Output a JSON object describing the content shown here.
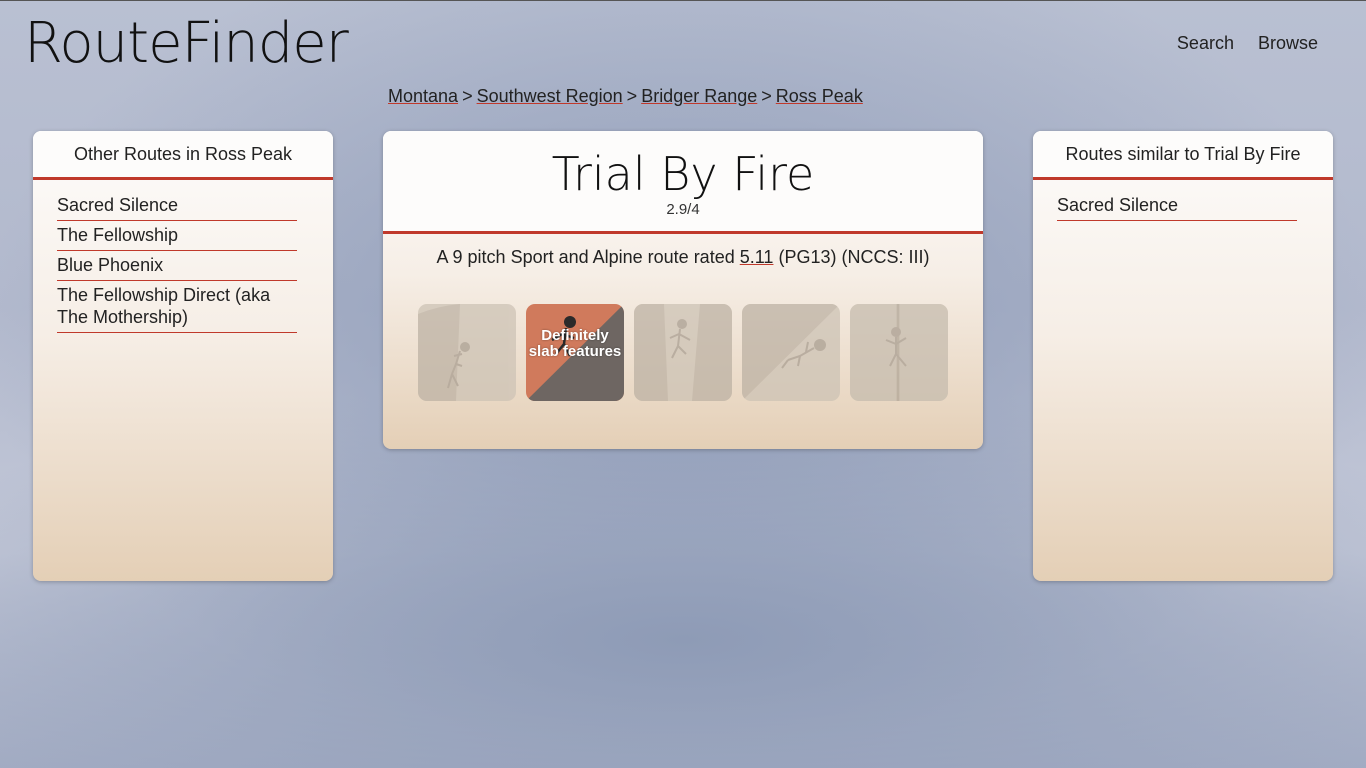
{
  "app": {
    "logo": "RouteFinder",
    "nav": {
      "search": "Search",
      "browse": "Browse"
    }
  },
  "breadcrumb": {
    "items": [
      "Montana",
      "Southwest Region",
      "Bridger Range",
      "Ross Peak"
    ],
    "separator": ">"
  },
  "left_panel": {
    "title": "Other Routes in Ross Peak",
    "routes": [
      "Sacred Silence",
      "The Fellowship",
      "Blue Phoenix",
      "The Fellowship Direct (aka The Mothership)"
    ]
  },
  "route": {
    "name": "Trial By Fire",
    "rating": "2.9/4",
    "desc_prefix": "A 9 pitch Sport and Alpine route rated",
    "grade": "5.11",
    "desc_suffix": "(PG13) (NCCS: III)"
  },
  "features": [
    {
      "icon": "face-climbing-icon",
      "active": false
    },
    {
      "icon": "slab-icon",
      "active": true,
      "label": "Definitely slab features"
    },
    {
      "icon": "chimney-icon",
      "active": false
    },
    {
      "icon": "overhang-icon",
      "active": false
    },
    {
      "icon": "crack-icon",
      "active": false
    }
  ],
  "right_panel": {
    "title": "Routes similar to Trial By Fire",
    "routes": [
      "Sacred Silence"
    ]
  },
  "colors": {
    "accent": "#c0392b",
    "slab_active_top": "#d07a5c",
    "slab_active_bottom": "#6e6662",
    "feature_inactive": "#cdc3b5"
  }
}
